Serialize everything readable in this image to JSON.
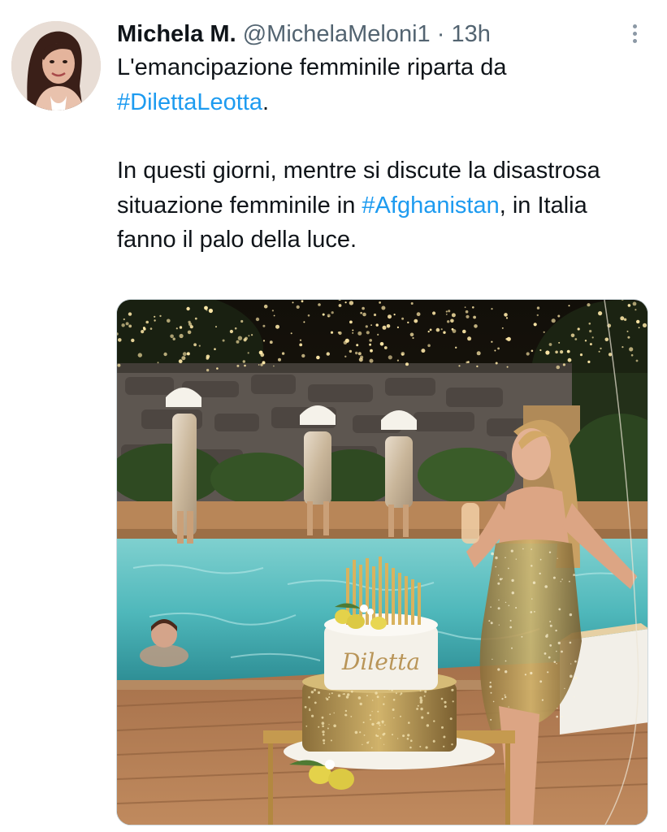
{
  "tweet": {
    "author": {
      "name": "Michela M.",
      "handle": "@MichelaMeloni1",
      "separator": "·",
      "time": "13h"
    },
    "body": {
      "line1_text": "L'emancipazione femminile riparta da",
      "hashtag1": "#DilettaLeotta",
      "after_hashtag1": ".",
      "para2_text": "In questi giorni, mentre si discute la disastrosa situazione femminile in",
      "hashtag2": "#Afghanistan",
      "para2_end": ", in Italia fanno il palo della luce."
    },
    "media": {
      "cake_text": "Diletta"
    },
    "icons": {
      "more": "more-vertical-icon"
    },
    "colors": {
      "hashtag": "#1d9bf0",
      "secondary_text": "#536471",
      "primary_text": "#0f1419"
    }
  }
}
